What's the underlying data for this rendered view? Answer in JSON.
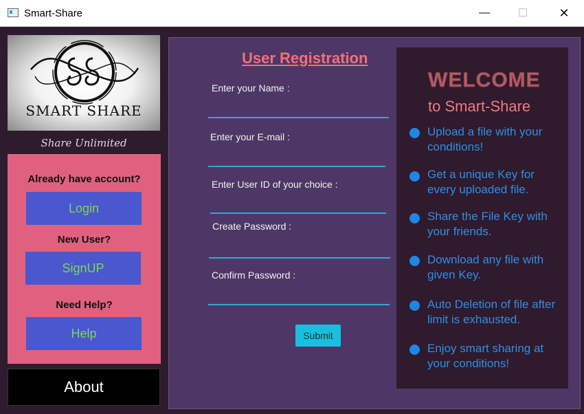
{
  "window": {
    "title": "Smart-Share",
    "min": "—",
    "max": "☐",
    "close": "✕"
  },
  "sidebar": {
    "logo_text": "SMART SHARE",
    "tagline": "Share Unlimited",
    "have_account_label": "Already have account?",
    "login": "Login",
    "new_user_label": "New User?",
    "signup": "SignUP",
    "need_help_label": "Need Help?",
    "help": "Help",
    "about": "About"
  },
  "form": {
    "title": "User Registration",
    "name_label": "Enter your Name :",
    "email_label": "Enter your E-mail :",
    "userid_label": "Enter User ID of your choice :",
    "password_label": "Create Password :",
    "confirm_label": "Confirm Password :",
    "name_value": "",
    "email_value": "",
    "userid_value": "",
    "password_value": "",
    "confirm_value": "",
    "submit": "Submit"
  },
  "welcome": {
    "title": "WELCOME",
    "subtitle": "to Smart-Share",
    "features": [
      "Upload a file with your conditions!",
      "Get a unique Key for every uploaded file.",
      "Share the File Key with your friends.",
      "Download any file with given Key.",
      "Auto Deletion of file after limit is exhausted.",
      "Enjoy smart sharing at your conditions!"
    ]
  },
  "colors": {
    "accent_pink": "#e0617f",
    "button_blue": "#4a57cf",
    "button_text_green": "#7cd94a",
    "main_purple": "#4e3766",
    "feature_blue": "#2f8fe2",
    "submit_cyan": "#18c0e0"
  },
  "icons": [
    "app-window-icon",
    "minimize-icon",
    "maximize-icon",
    "close-icon",
    "smart-share-logo",
    "bullet-icon"
  ]
}
